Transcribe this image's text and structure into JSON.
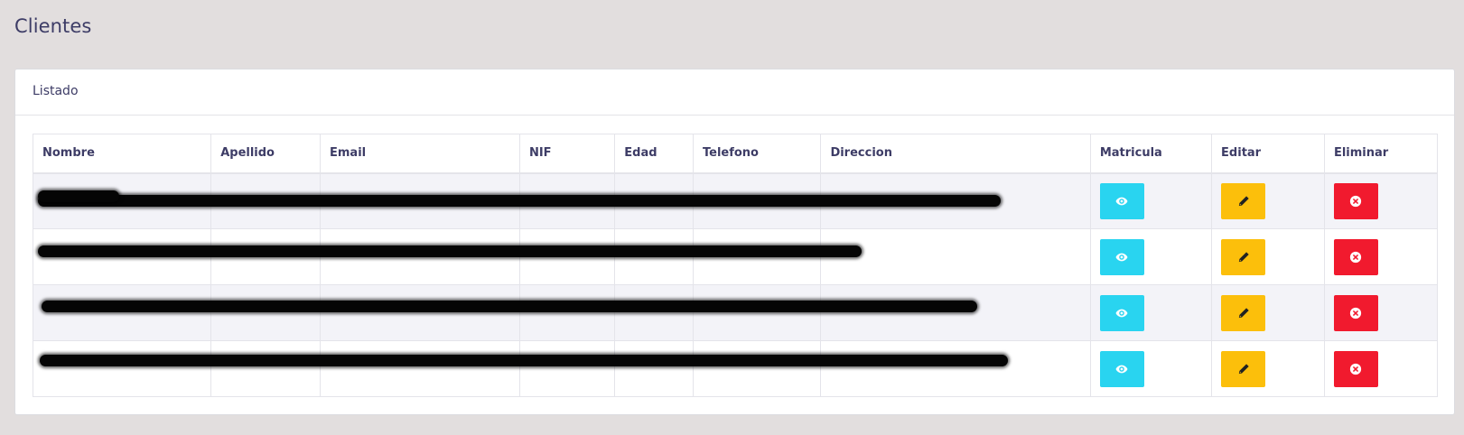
{
  "page": {
    "title": "Clientes"
  },
  "card": {
    "header": "Listado"
  },
  "table": {
    "columns": [
      "Nombre",
      "Apellido",
      "Email",
      "NIF",
      "Edad",
      "Telefono",
      "Direccion",
      "Matricula",
      "Editar",
      "Eliminar"
    ],
    "rows": [
      [
        "",
        "",
        "",
        "",
        "",
        "",
        ""
      ],
      [
        "",
        "",
        "",
        "",
        "",
        "",
        ""
      ],
      [
        "",
        "",
        "",
        "",
        "",
        "",
        ""
      ],
      [
        "",
        "",
        "",
        "",
        "",
        "",
        ""
      ]
    ]
  },
  "icons": {
    "view": "eye-icon",
    "edit": "pencil-icon",
    "delete": "times-circle-icon"
  },
  "colors": {
    "view": "#29d4f0",
    "edit": "#fcbf0b",
    "delete": "#f11a2e"
  }
}
